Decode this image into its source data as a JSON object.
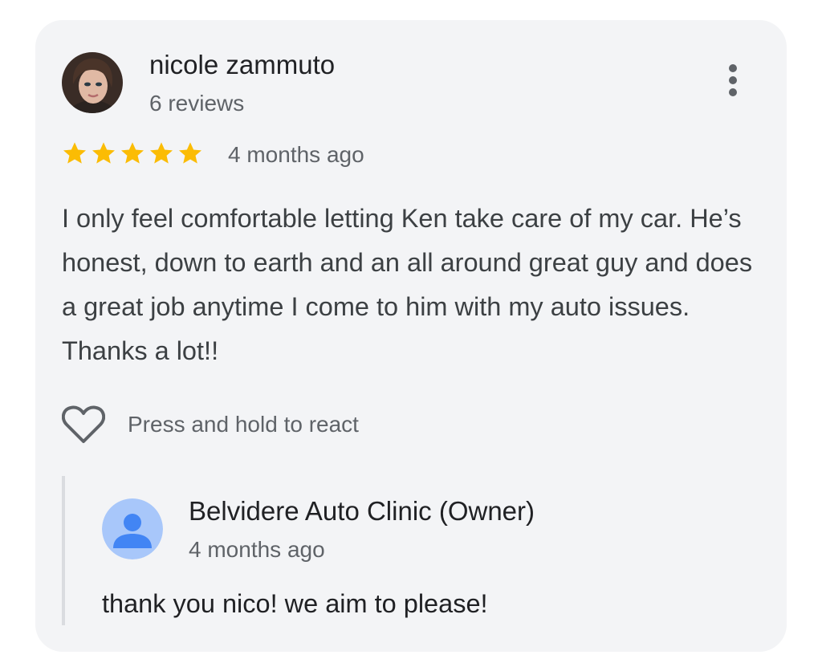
{
  "review": {
    "reviewer_name": "nicole zammuto",
    "review_count": "6 reviews",
    "rating": 5,
    "max_rating": 5,
    "date": "4 months ago",
    "text": "I only feel comfortable letting Ken take care of my car. He’s honest, down to earth and an all around great guy and does a great job anytime I come to him with my auto issues. Thanks a lot!!",
    "react_label": "Press and hold to react"
  },
  "reply": {
    "owner_name": "Belvidere Auto Clinic (Owner)",
    "date": "4 months ago",
    "text": "thank you nico! we aim to please!"
  },
  "icons": {
    "more": "more-vert-icon",
    "star": "star-icon",
    "heart": "heart-outline-icon",
    "owner_avatar": "default-person-avatar-icon"
  },
  "colors": {
    "card_bg": "#f3f4f6",
    "star": "#fbbc04",
    "primary_text": "#202124",
    "secondary_text": "#5f6368",
    "owner_avatar_bg": "#a8c7fa",
    "owner_avatar_fg": "#4285f4",
    "reply_rule": "#dadce0"
  }
}
